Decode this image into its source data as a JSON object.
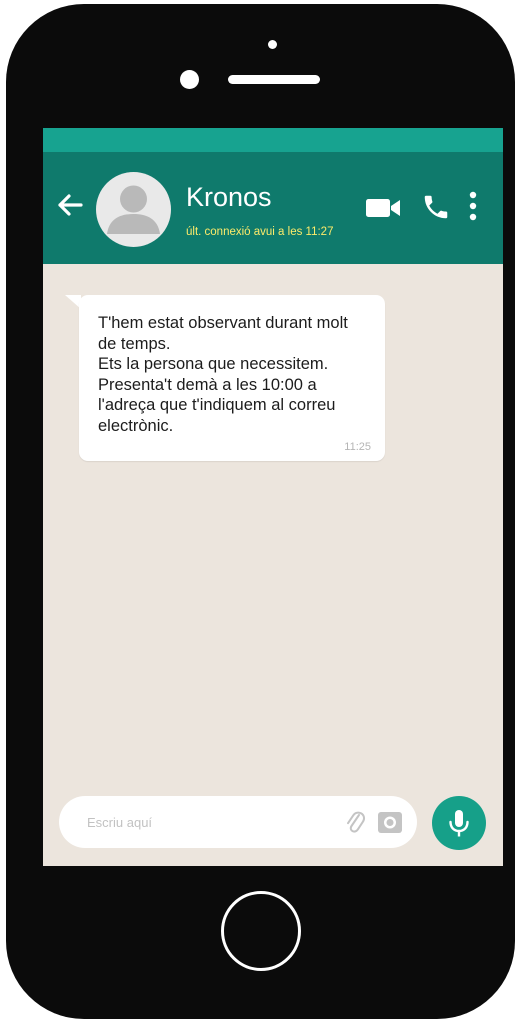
{
  "header": {
    "contact_name": "Kronos",
    "last_seen": "últ. connexió avui a les 11:27"
  },
  "icons": {
    "back": "back-arrow-icon",
    "avatar": "user-avatar-icon",
    "video": "video-camera-icon",
    "call": "phone-icon",
    "menu": "vertical-dots-menu-icon",
    "attach": "paperclip-icon",
    "camera": "camera-icon",
    "mic": "microphone-icon"
  },
  "message": {
    "lines": [
      "T'hem estat observant durant molt",
      "de temps.",
      "Ets la persona que necessitem.",
      "Presenta't demà a les 10:00 a",
      "l'adreça que t'indiquem al correu",
      "electrònic."
    ],
    "time": "11:25"
  },
  "composer": {
    "placeholder": "Escriu aquí"
  },
  "colors": {
    "header": "#0f7a6c",
    "status_bar": "#17a390",
    "last_seen": "#fdeb6a",
    "chat_background": "#ece5dd",
    "mic_button": "#16a089",
    "phone_body": "#0b0b0b"
  }
}
